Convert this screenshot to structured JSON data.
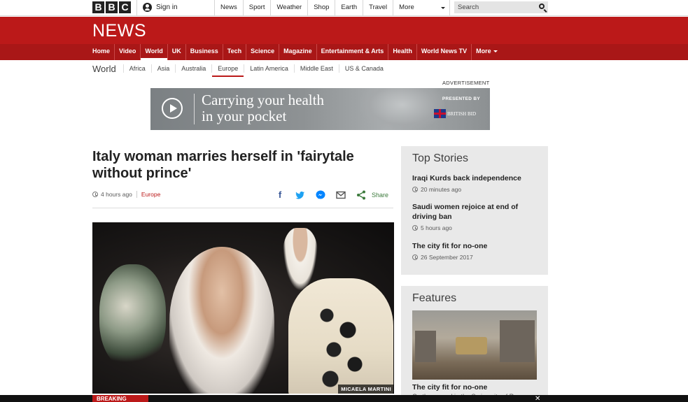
{
  "topbar": {
    "logo_letters": [
      "B",
      "B",
      "C"
    ],
    "signin_label": "Sign in",
    "nav": [
      "News",
      "Sport",
      "Weather",
      "Shop",
      "Earth",
      "Travel"
    ],
    "more_label": "More",
    "search_placeholder": "Search"
  },
  "news": {
    "title": "NEWS",
    "nav": [
      "Home",
      "Video",
      "World",
      "UK",
      "Business",
      "Tech",
      "Science",
      "Magazine",
      "Entertainment & Arts",
      "Health",
      "World News TV"
    ],
    "more_label": "More",
    "active_item": "World"
  },
  "subnav": {
    "section": "World",
    "items": [
      "Africa",
      "Asia",
      "Australia",
      "Europe",
      "Latin America",
      "Middle East",
      "US & Canada"
    ],
    "active_item": "Europe"
  },
  "ad": {
    "label": "ADVERTISEMENT",
    "headline_line1": "Carrying your health",
    "headline_line2": "in your pocket",
    "presented_by": "PRESENTED BY",
    "sponsor": "BRITISH BID"
  },
  "article": {
    "headline": "Italy woman marries herself in 'fairytale without prince'",
    "timestamp": "4 hours ago",
    "category": "Europe",
    "share_label": "Share",
    "image_credit": "MICAELA MARTINI"
  },
  "top_stories": {
    "title": "Top Stories",
    "items": [
      {
        "title": "Iraqi Kurds back independence",
        "time": "20 minutes ago"
      },
      {
        "title": "Saudi women rejoice at end of driving ban",
        "time": "5 hours ago"
      },
      {
        "title": "The city fit for no-one",
        "time": "26 September 2017"
      }
    ]
  },
  "features": {
    "title": "Features",
    "item_title": "The city fit for no-one",
    "item_sub": "On the ground in the Syrian city of Raqqa"
  },
  "breaking": {
    "label": "BREAKING"
  },
  "colors": {
    "bbc_red": "#bb1919",
    "nav_red": "#a91717",
    "panel_grey": "#e9e9e9"
  }
}
